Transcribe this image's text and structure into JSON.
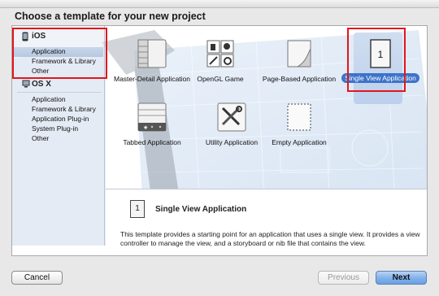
{
  "heading": "Choose a template for your new project",
  "sidebar": {
    "ios": {
      "label": "iOS",
      "items": [
        "Application",
        "Framework & Library",
        "Other"
      ],
      "selected": "Application"
    },
    "osx": {
      "label": "OS X",
      "items": [
        "Application",
        "Framework & Library",
        "Application Plug-in",
        "System Plug-in",
        "Other"
      ]
    }
  },
  "templates": [
    {
      "label": "Master-Detail Application",
      "icon": "master-detail-icon"
    },
    {
      "label": "OpenGL Game",
      "icon": "opengl-game-icon"
    },
    {
      "label": "Page-Based Application",
      "icon": "page-based-icon"
    },
    {
      "label": "Single View Application",
      "icon": "single-view-icon",
      "selected": true
    },
    {
      "label": "Tabbed Application",
      "icon": "tabbed-icon"
    },
    {
      "label": "Utility Application",
      "icon": "utility-icon"
    },
    {
      "label": "Empty Application",
      "icon": "empty-icon"
    }
  ],
  "description": {
    "icon_text": "1",
    "title": "Single View Application",
    "text": "This template provides a starting point for an application that uses a single view. It provides a view controller to manage the view, and a storyboard or nib file that contains the view."
  },
  "buttons": {
    "cancel": "Cancel",
    "previous": "Previous",
    "next": "Next"
  },
  "colors": {
    "selection_blue": "#3d73c9",
    "annotation_red": "#e3161c"
  }
}
